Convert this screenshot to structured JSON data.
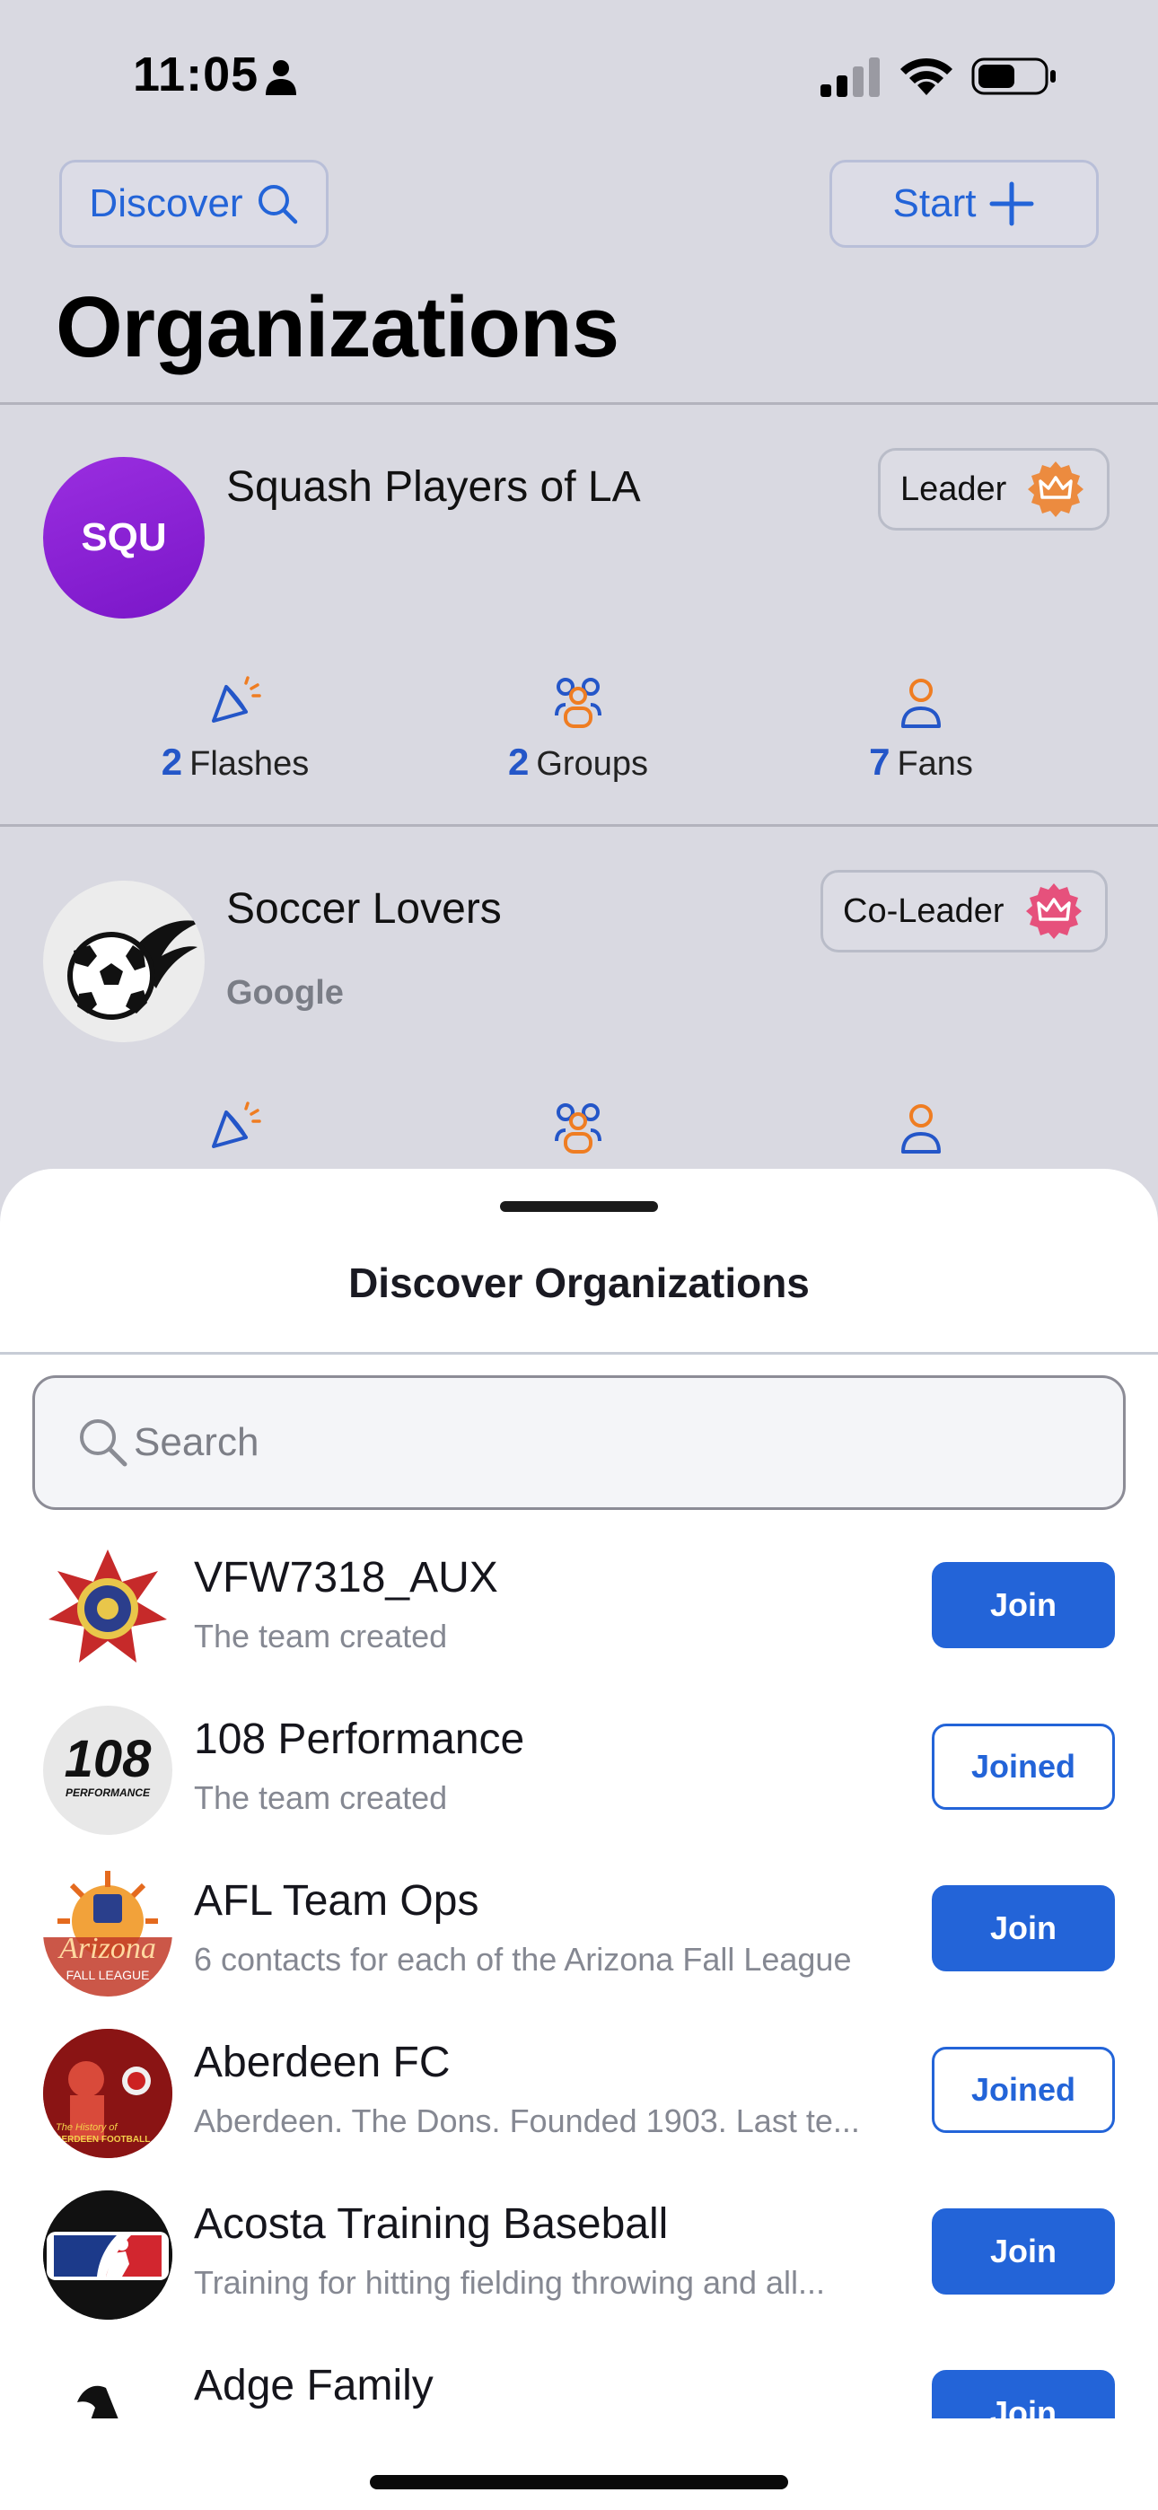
{
  "status_bar": {
    "time": "11:05"
  },
  "header": {
    "discover_label": "Discover",
    "start_label": "Start",
    "page_title": "Organizations"
  },
  "my_orgs": [
    {
      "avatar_text": "SQU",
      "name": "Squash Players of LA",
      "subtitle": "",
      "role": "Leader",
      "role_color": "#ef7d22",
      "flashes_count": "2",
      "flashes_label": "Flashes",
      "groups_count": "2",
      "groups_label": "Groups",
      "fans_count": "7",
      "fans_label": "Fans"
    },
    {
      "avatar_text": "",
      "name": "Soccer Lovers",
      "subtitle": "Google",
      "role": "Co-Leader",
      "role_color": "#e8386a"
    }
  ],
  "sheet": {
    "title": "Discover Organizations",
    "search_placeholder": "Search",
    "items": [
      {
        "name": "VFW7318_AUX",
        "desc": "The team created",
        "action": "Join",
        "state": "join"
      },
      {
        "name": "108 Performance",
        "desc": "The team created",
        "action": "Joined",
        "state": "joined",
        "logo_text": "108",
        "logo_sub": "PERFORMANCE"
      },
      {
        "name": "AFL Team Ops",
        "desc": "6 contacts for each of the Arizona Fall League",
        "action": "Join",
        "state": "join",
        "logo_text": "Arizona",
        "logo_sub": "FALL LEAGUE"
      },
      {
        "name": "Aberdeen FC",
        "desc": "Aberdeen. The Dons. Founded 1903. Last te...",
        "action": "Joined",
        "state": "joined",
        "logo_text": "The History of",
        "logo_sub": "ABERDEEN FOOTBALL"
      },
      {
        "name": "Acosta Training Baseball",
        "desc": "Training for hitting fielding  throwing and all...",
        "action": "Join",
        "state": "join"
      },
      {
        "name": "Adge Family",
        "desc": "",
        "action": "Join",
        "state": "join"
      }
    ]
  },
  "colors": {
    "accent": "#2364d8",
    "background": "#d9d9e1",
    "count_blue": "#2456c8",
    "icon_orange": "#ef7d22"
  }
}
